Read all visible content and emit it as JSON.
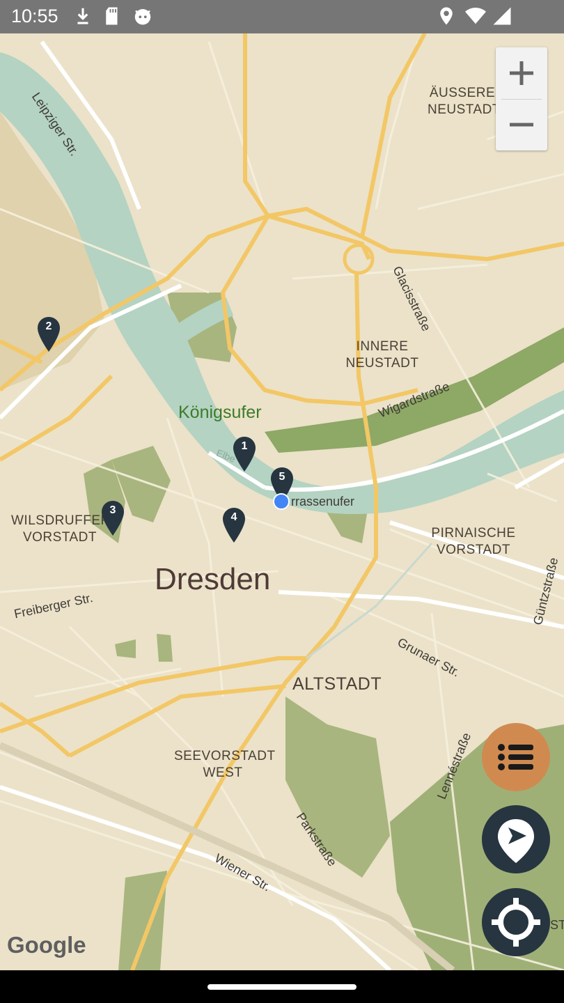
{
  "status_bar": {
    "time": "10:55",
    "icons": [
      "download-icon",
      "sd-card-icon",
      "cat-icon",
      "location-icon",
      "wifi-icon",
      "battery-icon"
    ]
  },
  "map": {
    "districts": [
      {
        "line1": "ÄUSSERE",
        "line2": "NEUSTADT"
      },
      {
        "line1": "INNERE",
        "line2": "NEUSTADT"
      },
      {
        "line1": "WILSDRUFFER",
        "line2": "VORSTADT"
      },
      {
        "line1": "PIRNAISCHE",
        "line2": "VORSTADT"
      },
      {
        "line1": "ALTSTADT",
        "line2": ""
      },
      {
        "line1": "SEEVORSTADT",
        "line2": "WEST"
      }
    ],
    "city": "Dresden",
    "park": "Königsufer",
    "river": "Elbe",
    "streets": {
      "leipziger": "Leipziger Str.",
      "glacis": "Glacisstraße",
      "wigard": "Wigardstraße",
      "terrassenufer": "rrassenufer",
      "freiberger": "Freiberger Str.",
      "guentz": "Güntzstraße",
      "grunaer": "Grunaer Str.",
      "lenne": "Lennéstraße",
      "park": "Parkstraße",
      "wiener": "Wiener Str.",
      "edge": "ST"
    },
    "pins": [
      "1",
      "2",
      "3",
      "4",
      "5"
    ],
    "attribution": "Google"
  },
  "controls": {
    "zoom_in": "+",
    "zoom_out": "−",
    "list_button_color": "#d08a50",
    "fab_color": "#263540"
  }
}
